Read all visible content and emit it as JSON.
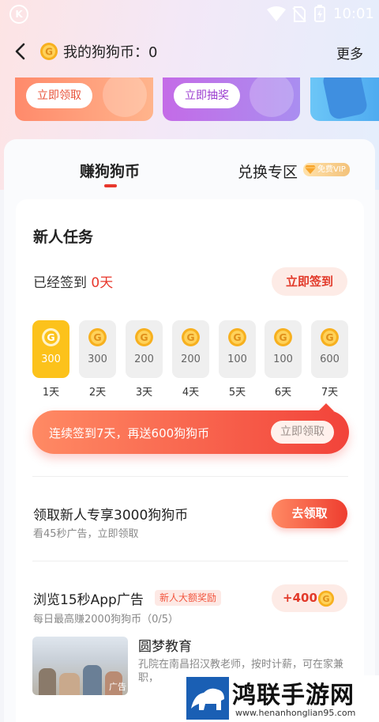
{
  "status_bar": {
    "time": "10:01"
  },
  "nav": {
    "title": "我的狗狗币：0",
    "more_label": "更多"
  },
  "banners": [
    {
      "button_label": "立即领取"
    },
    {
      "button_label": "立即抽奖"
    }
  ],
  "tabs": {
    "earn_label": "赚狗狗币",
    "exchange_label": "兑换专区",
    "vip_badge": "免费VIP"
  },
  "newbie": {
    "title": "新人任务",
    "signed_prefix": "已经签到 ",
    "signed_days": "0天",
    "sign_button": "立即签到",
    "days": [
      {
        "value": "300",
        "label": "1天",
        "active": true
      },
      {
        "value": "300",
        "label": "2天",
        "active": false
      },
      {
        "value": "200",
        "label": "3天",
        "active": false
      },
      {
        "value": "200",
        "label": "4天",
        "active": false
      },
      {
        "value": "100",
        "label": "5天",
        "active": false
      },
      {
        "value": "100",
        "label": "6天",
        "active": false
      },
      {
        "value": "600",
        "label": "7天",
        "active": false
      }
    ],
    "streak_text": "连续签到7天，再送600狗狗币",
    "streak_button": "立即领取"
  },
  "tasks": [
    {
      "title": "领取新人专享3000狗狗币",
      "subtitle": "看45秒广告，立即领取",
      "button": "去领取"
    },
    {
      "title": "浏览15秒App广告",
      "tag": "新人大额奖励",
      "subtitle": "每日最高赚2000狗狗币（0/5）",
      "reward": "+400"
    }
  ],
  "ad": {
    "title": "圆梦教育",
    "description": "孔院在南昌招汉教老师，按时计薪，可在家兼职，",
    "badge": "广告"
  },
  "watermark": {
    "title": "鸿联手游网",
    "url": "www.henanhonglian95.com"
  },
  "colors": {
    "accent_red": "#e8372c",
    "coin_gold": "#fcc21b"
  }
}
